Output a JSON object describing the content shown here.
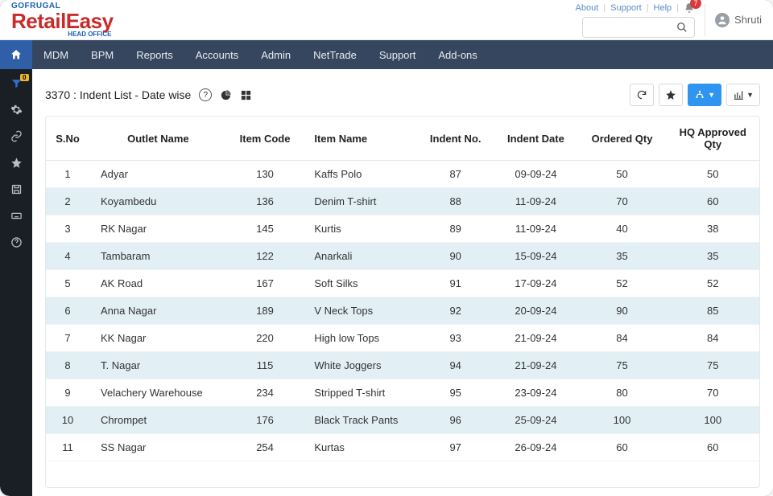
{
  "header": {
    "logo_go": "GOFRUGAL",
    "logo_main": "RetailEasy",
    "logo_sub": "HEAD OFFICE",
    "links": {
      "about": "About",
      "support": "Support",
      "help": "Help"
    },
    "bell_badge": "7",
    "user_name": "Shruti"
  },
  "nav": [
    "MDM",
    "BPM",
    "Reports",
    "Accounts",
    "Admin",
    "NetTrade",
    "Support",
    "Add-ons"
  ],
  "sidebar_filter_badge": "0",
  "page": {
    "title": "3370 : Indent List - Date wise"
  },
  "table": {
    "headers": {
      "sno": "S.No",
      "outlet": "Outlet Name",
      "code": "Item Code",
      "item": "Item Name",
      "indent_no": "Indent No.",
      "indent_date": "Indent Date",
      "ordered": "Ordered Qty",
      "hq": "HQ Approved Qty"
    },
    "rows": [
      {
        "sno": "1",
        "outlet": "Adyar",
        "code": "130",
        "item": "Kaffs Polo",
        "indent_no": "87",
        "indent_date": "09-09-24",
        "ordered": "50",
        "hq": "50"
      },
      {
        "sno": "2",
        "outlet": "Koyambedu",
        "code": "136",
        "item": "Denim T-shirt",
        "indent_no": "88",
        "indent_date": "11-09-24",
        "ordered": "70",
        "hq": "60"
      },
      {
        "sno": "3",
        "outlet": "RK Nagar",
        "code": "145",
        "item": "Kurtis",
        "indent_no": "89",
        "indent_date": "11-09-24",
        "ordered": "40",
        "hq": "38"
      },
      {
        "sno": "4",
        "outlet": "Tambaram",
        "code": "122",
        "item": "Anarkali",
        "indent_no": "90",
        "indent_date": "15-09-24",
        "ordered": "35",
        "hq": "35"
      },
      {
        "sno": "5",
        "outlet": "AK Road",
        "code": "167",
        "item": "Soft Silks",
        "indent_no": "91",
        "indent_date": "17-09-24",
        "ordered": "52",
        "hq": "52"
      },
      {
        "sno": "6",
        "outlet": "Anna Nagar",
        "code": "189",
        "item": "V Neck Tops",
        "indent_no": "92",
        "indent_date": "20-09-24",
        "ordered": "90",
        "hq": "85"
      },
      {
        "sno": "7",
        "outlet": "KK Nagar",
        "code": "220",
        "item": "High low Tops",
        "indent_no": "93",
        "indent_date": "21-09-24",
        "ordered": "84",
        "hq": "84"
      },
      {
        "sno": "8",
        "outlet": "T. Nagar",
        "code": "115",
        "item": "White Joggers",
        "indent_no": "94",
        "indent_date": "21-09-24",
        "ordered": "75",
        "hq": "75"
      },
      {
        "sno": "9",
        "outlet": "Velachery Warehouse",
        "code": "234",
        "item": "Stripped T-shirt",
        "indent_no": "95",
        "indent_date": "23-09-24",
        "ordered": "80",
        "hq": "70"
      },
      {
        "sno": "10",
        "outlet": "Chrompet",
        "code": "176",
        "item": "Black Track Pants",
        "indent_no": "96",
        "indent_date": "25-09-24",
        "ordered": "100",
        "hq": "100"
      },
      {
        "sno": "11",
        "outlet": "SS Nagar",
        "code": "254",
        "item": "Kurtas",
        "indent_no": "97",
        "indent_date": "26-09-24",
        "ordered": "60",
        "hq": "60"
      }
    ]
  }
}
